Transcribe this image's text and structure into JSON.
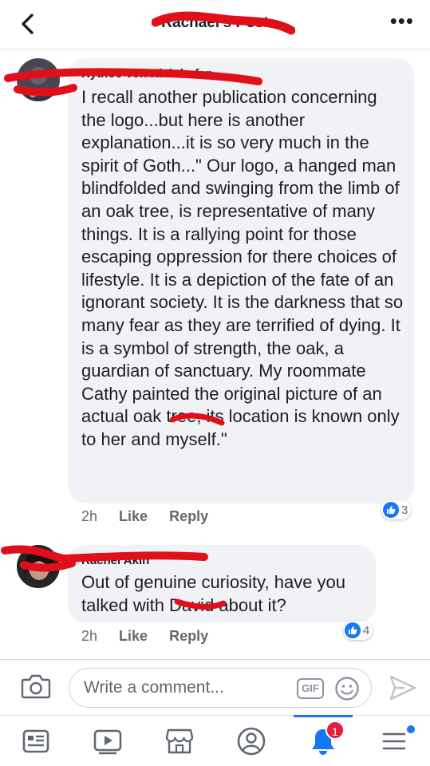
{
  "header": {
    "title": "Rachael's Post"
  },
  "comments": [
    {
      "author": "Rythoe Von Richthofen",
      "text": "I recall another publication concerning the logo...but here is another explanation...it is so very much in the spirit of Goth...\" Our logo, a hanged man blindfolded and swinging from the limb of an oak tree, is representative of many things. It is a rallying point for those escaping oppression for there choices of lifestyle. It is a depiction of the fate of an ignorant society. It is the darkness that so many fear as they are terrified of dying. It is a symbol of strength, the oak, a guardian of sanctuary. My roommate Cathy painted the original picture of an actual oak tree, its location is known only to her and myself.\"",
      "time": "2h",
      "like_label": "Like",
      "reply_label": "Reply",
      "reaction_count": "3"
    },
    {
      "author": "Rachel Akin",
      "text": "Out of genuine curiosity, have you talked with David about it?",
      "time": "2h",
      "like_label": "Like",
      "reply_label": "Reply",
      "reaction_count": "4"
    }
  ],
  "composer": {
    "placeholder": "Write a comment...",
    "gif_label": "GIF"
  },
  "tabs": [
    {
      "icon": "news-feed-icon"
    },
    {
      "icon": "watch-icon"
    },
    {
      "icon": "marketplace-icon"
    },
    {
      "icon": "profile-icon"
    },
    {
      "icon": "notifications-icon",
      "badge": "1"
    },
    {
      "icon": "menu-icon"
    }
  ],
  "colors": {
    "accent": "#1877f2",
    "bubble": "#f0f2f5",
    "badge": "#e41e3f",
    "redaction": "#e0101a"
  }
}
